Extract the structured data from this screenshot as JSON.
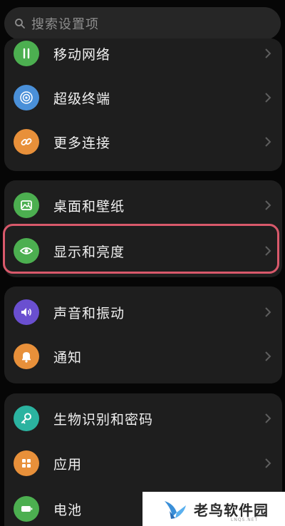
{
  "search": {
    "placeholder": "搜索设置项"
  },
  "groups": [
    {
      "items": [
        {
          "label": "移动网络",
          "icon": "mobile-network-icon",
          "color": "#4caf50"
        },
        {
          "label": "超级终端",
          "icon": "super-device-icon",
          "color": "#4a90d9"
        },
        {
          "label": "更多连接",
          "icon": "link-icon",
          "color": "#e8903a"
        }
      ]
    },
    {
      "items": [
        {
          "label": "桌面和壁纸",
          "icon": "wallpaper-icon",
          "color": "#4caf50"
        },
        {
          "label": "显示和亮度",
          "icon": "eye-icon",
          "color": "#4caf50",
          "highlighted": true
        }
      ]
    },
    {
      "items": [
        {
          "label": "声音和振动",
          "icon": "volume-icon",
          "color": "#6a4fd0"
        },
        {
          "label": "通知",
          "icon": "bell-icon",
          "color": "#e8903a"
        }
      ]
    },
    {
      "items": [
        {
          "label": "生物识别和密码",
          "icon": "key-icon",
          "color": "#2bb3a0"
        },
        {
          "label": "应用",
          "icon": "apps-icon",
          "color": "#e8903a"
        },
        {
          "label": "电池",
          "icon": "battery-icon",
          "color": "#4caf50"
        }
      ]
    }
  ],
  "highlight_color": "#d9596b",
  "watermark": {
    "text": "老鸟软件园",
    "url": "LNQS.NET"
  }
}
